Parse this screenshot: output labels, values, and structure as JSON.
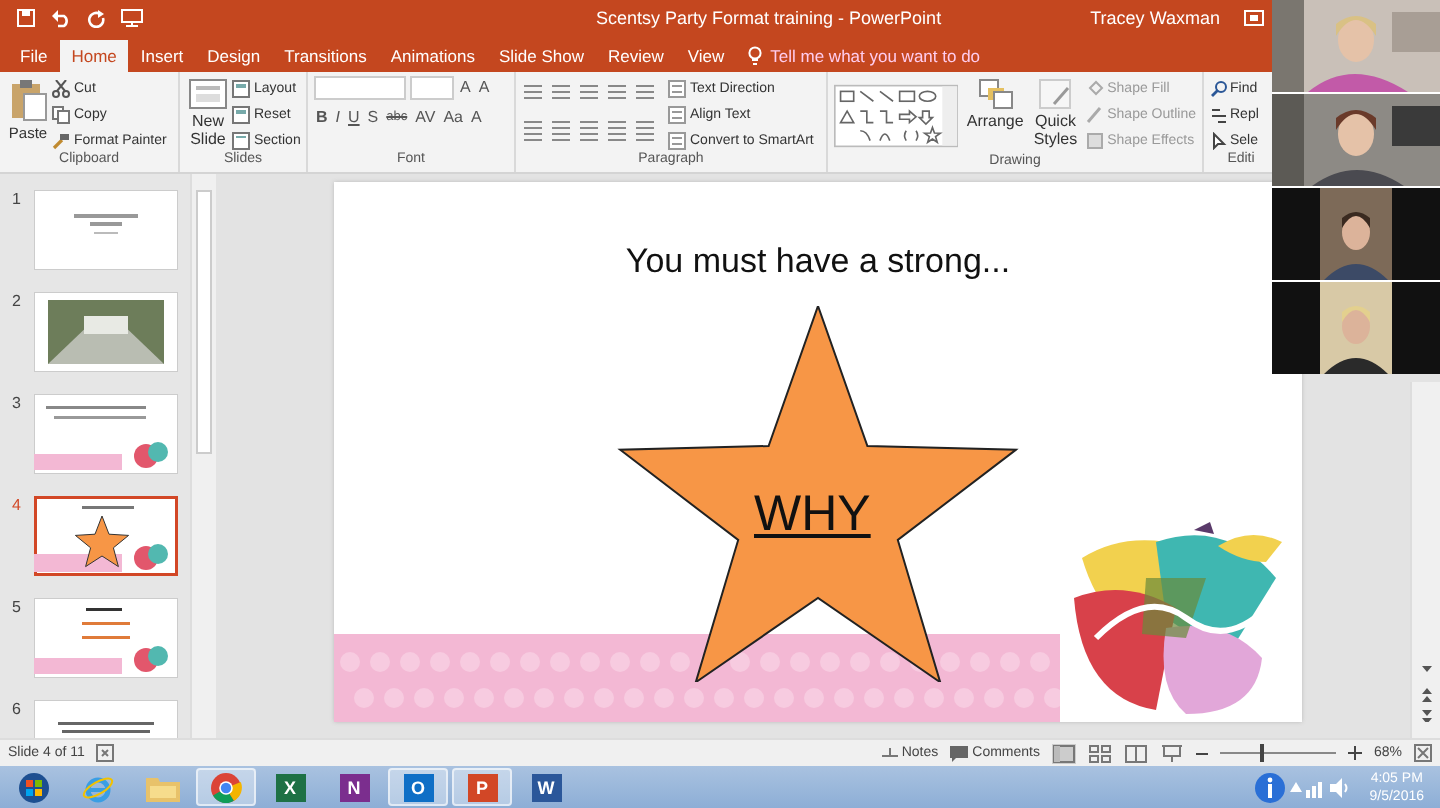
{
  "window": {
    "title": "Scentsy Party Format training - PowerPoint",
    "user": "Tracey Waxman"
  },
  "tabs": [
    {
      "label": "File",
      "selected": false
    },
    {
      "label": "Home",
      "selected": true
    },
    {
      "label": "Insert",
      "selected": false
    },
    {
      "label": "Design",
      "selected": false
    },
    {
      "label": "Transitions",
      "selected": false
    },
    {
      "label": "Animations",
      "selected": false
    },
    {
      "label": "Slide Show",
      "selected": false
    },
    {
      "label": "Review",
      "selected": false
    },
    {
      "label": "View",
      "selected": false
    }
  ],
  "tell_me": {
    "placeholder": "Tell me what you want to do"
  },
  "ribbon": {
    "clipboard": {
      "label": "Clipboard",
      "paste": "Paste",
      "commands": [
        "Cut",
        "Copy",
        "Format Painter"
      ]
    },
    "slides": {
      "label": "Slides",
      "new_slide": [
        "New",
        "Slide"
      ],
      "commands": [
        "Layout",
        "Reset",
        "Section"
      ]
    },
    "font": {
      "label": "Font",
      "size_buttons": [
        "A",
        "A"
      ],
      "format_buttons": [
        "B",
        "I",
        "U",
        "S",
        "abc",
        "AV",
        "Aa",
        "A"
      ]
    },
    "paragraph": {
      "label": "Paragraph",
      "commands": [
        "Text Direction",
        "Align Text",
        "Convert to SmartArt"
      ]
    },
    "drawing": {
      "label": "Drawing",
      "arrange": "Arrange",
      "quick_styles": [
        "Quick",
        "Styles"
      ],
      "commands": [
        "Shape Fill",
        "Shape Outline",
        "Shape Effects"
      ]
    },
    "editing": {
      "label": "Editi",
      "commands": [
        "Find",
        "Repl",
        "Sele"
      ]
    }
  },
  "thumbnails": [
    {
      "number": "1",
      "kind": "title",
      "selected": false
    },
    {
      "number": "2",
      "selected": false
    },
    {
      "number": "3",
      "kind": "bullets",
      "selected": false
    },
    {
      "number": "4",
      "kind": "star",
      "selected": true
    },
    {
      "number": "5",
      "kind": "lines",
      "selected": false
    },
    {
      "number": "6",
      "kind": "text",
      "selected": false
    }
  ],
  "slide": {
    "title": "You must have a strong...",
    "shape_text": "WHY"
  },
  "status_bar": {
    "slide_info": "Slide 4 of 11",
    "notes": "Notes",
    "comments": "Comments",
    "zoom": {
      "level": 0.35
    },
    "zoom_text": "68%"
  },
  "taskbar": {
    "apps": [
      {
        "kind": "start",
        "running": false
      },
      {
        "kind": "ie",
        "running": false
      },
      {
        "kind": "folder",
        "running": false
      },
      {
        "kind": "chrome",
        "running": true
      },
      {
        "kind": "tile",
        "label": "X",
        "color": "#1e7145",
        "running": false
      },
      {
        "kind": "tile",
        "label": "N",
        "color": "#7b2e8e",
        "running": false
      },
      {
        "kind": "tile",
        "label": "O",
        "color": "#0f6fc6",
        "running": true
      },
      {
        "kind": "tile",
        "label": "P",
        "color": "#d24726",
        "running": true
      },
      {
        "kind": "tile",
        "label": "W",
        "color": "#2b579a",
        "running": false
      }
    ],
    "time": "4:05 PM",
    "date": "9/5/2016"
  }
}
